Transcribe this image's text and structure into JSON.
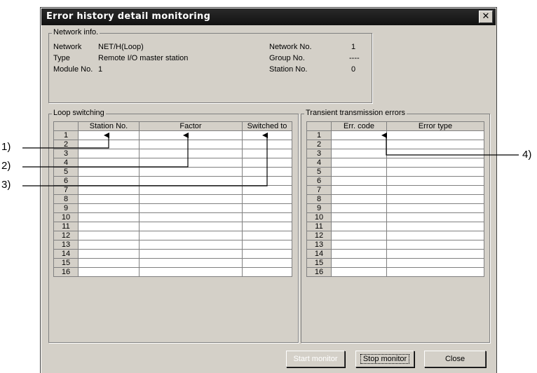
{
  "window": {
    "title": "Error history detail monitoring"
  },
  "network_info": {
    "label": "Network info.",
    "network_label": "Network",
    "network_value": "NET/H(Loop)",
    "type_label": "Type",
    "type_value": "Remote I/O master station",
    "module_label": "Module No.",
    "module_value": "1",
    "network_no_label": "Network No.",
    "network_no_value": "1",
    "group_no_label": "Group No.",
    "group_no_value": "----",
    "station_no_label": "Station No.",
    "station_no_value": "0"
  },
  "loop_switching": {
    "label": "Loop switching",
    "columns": [
      "",
      "Station No.",
      "Factor",
      "Switched to"
    ],
    "rows": [
      "1",
      "2",
      "3",
      "4",
      "5",
      "6",
      "7",
      "8",
      "9",
      "10",
      "11",
      "12",
      "13",
      "14",
      "15",
      "16"
    ]
  },
  "transient_errors": {
    "label": "Transient transmission errors",
    "columns": [
      "",
      "Err. code",
      "Error type"
    ],
    "rows": [
      "1",
      "2",
      "3",
      "4",
      "5",
      "6",
      "7",
      "8",
      "9",
      "10",
      "11",
      "12",
      "13",
      "14",
      "15",
      "16"
    ]
  },
  "buttons": {
    "start": "Start monitor",
    "stop": "Stop monitor",
    "close": "Close"
  },
  "callouts": [
    "1)",
    "2)",
    "3)",
    "4)"
  ]
}
